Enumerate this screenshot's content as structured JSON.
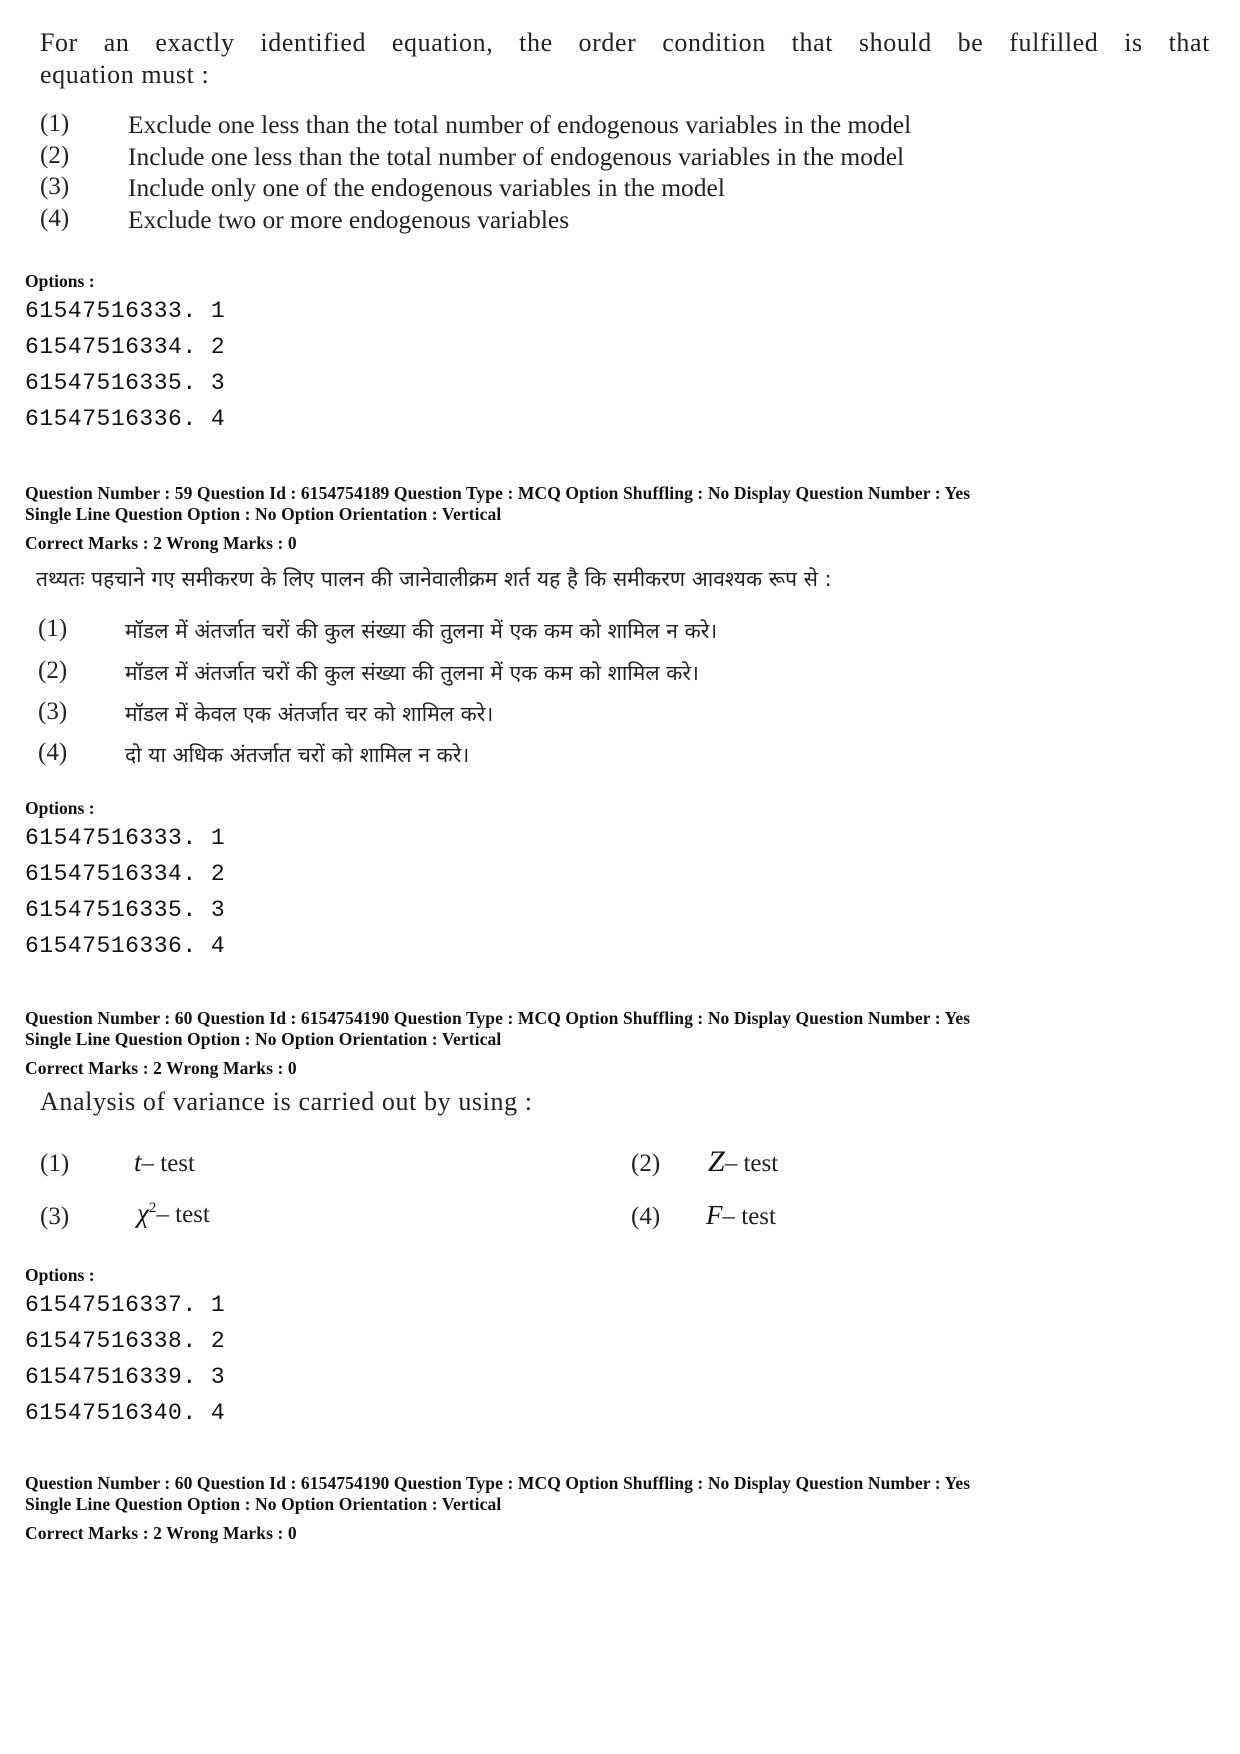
{
  "block1": {
    "question_en": {
      "line1": "For an exactly identified equation, the order condition that should be fulfilled is that",
      "line2": "equation must :",
      "choices": [
        {
          "num": "(1)",
          "text": "Exclude one less than the total number of endogenous  variables in the model"
        },
        {
          "num": "(2)",
          "text": "Include one less than the total number of endogenous variables in the model"
        },
        {
          "num": "(3)",
          "text": "Include only one of the endogenous variables in the model"
        },
        {
          "num": "(4)",
          "text": "Exclude two or more endogenous variables"
        }
      ]
    },
    "options_label": "Options :",
    "options": [
      "61547516333. 1",
      "61547516334. 2",
      "61547516335. 3",
      "61547516336. 4"
    ]
  },
  "block2": {
    "meta_line1": "Question Number : 59  Question Id : 6154754189  Question Type : MCQ  Option Shuffling : No  Display Question Number : Yes",
    "meta_line2": "Single Line Question Option : No  Option Orientation : Vertical",
    "marks_line": "Correct Marks : 2  Wrong Marks : 0",
    "question_hi": {
      "stem": "तथ्यतः पहचाने गए समीकरण के लिए पालन की जानेवालीक्रम शर्त यह है कि समीकरण आवश्यक रूप से :",
      "choices": [
        {
          "num": "(1)",
          "text": "मॉडल में अंतर्जात चरों की कुल संख्या की तुलना में एक कम को शामिल न करे।"
        },
        {
          "num": "(2)",
          "text": "मॉडल में अंतर्जात चरों की कुल संख्या की तुलना में एक कम को शामिल करे।"
        },
        {
          "num": "(3)",
          "text": "मॉडल में केवल एक अंतर्जात चर को शामिल करे।"
        },
        {
          "num": "(4)",
          "text": "दो या अधिक अंतर्जात चरों को शामिल न करे।"
        }
      ]
    },
    "options_label": "Options :",
    "options": [
      "61547516333. 1",
      "61547516334. 2",
      "61547516335. 3",
      "61547516336. 4"
    ]
  },
  "block3": {
    "meta_line1": "Question Number : 60  Question Id : 6154754190  Question Type : MCQ  Option Shuffling : No  Display Question Number : Yes",
    "meta_line2": "Single Line Question Option : No  Option Orientation : Vertical",
    "marks_line": "Correct Marks : 2  Wrong Marks : 0",
    "question_en": {
      "stem": "Analysis of variance is carried out by using :",
      "choices": [
        {
          "num": "(1)",
          "symbol": "t",
          "sup": "",
          "suffix": "– test"
        },
        {
          "num": "(2)",
          "symbol": "Z",
          "sup": "",
          "suffix": "– test"
        },
        {
          "num": "(3)",
          "symbol": "χ",
          "sup": "2",
          "suffix": "– test"
        },
        {
          "num": "(4)",
          "symbol": "F",
          "sup": "",
          "suffix": "– test"
        }
      ]
    },
    "options_label": "Options :",
    "options": [
      "61547516337. 1",
      "61547516338. 2",
      "61547516339. 3",
      "61547516340. 4"
    ]
  },
  "block4": {
    "meta_line1": "Question Number : 60  Question Id : 6154754190  Question Type : MCQ  Option Shuffling : No  Display Question Number : Yes",
    "meta_line2": "Single Line Question Option : No  Option Orientation : Vertical",
    "marks_line": "Correct Marks : 2  Wrong Marks : 0"
  }
}
